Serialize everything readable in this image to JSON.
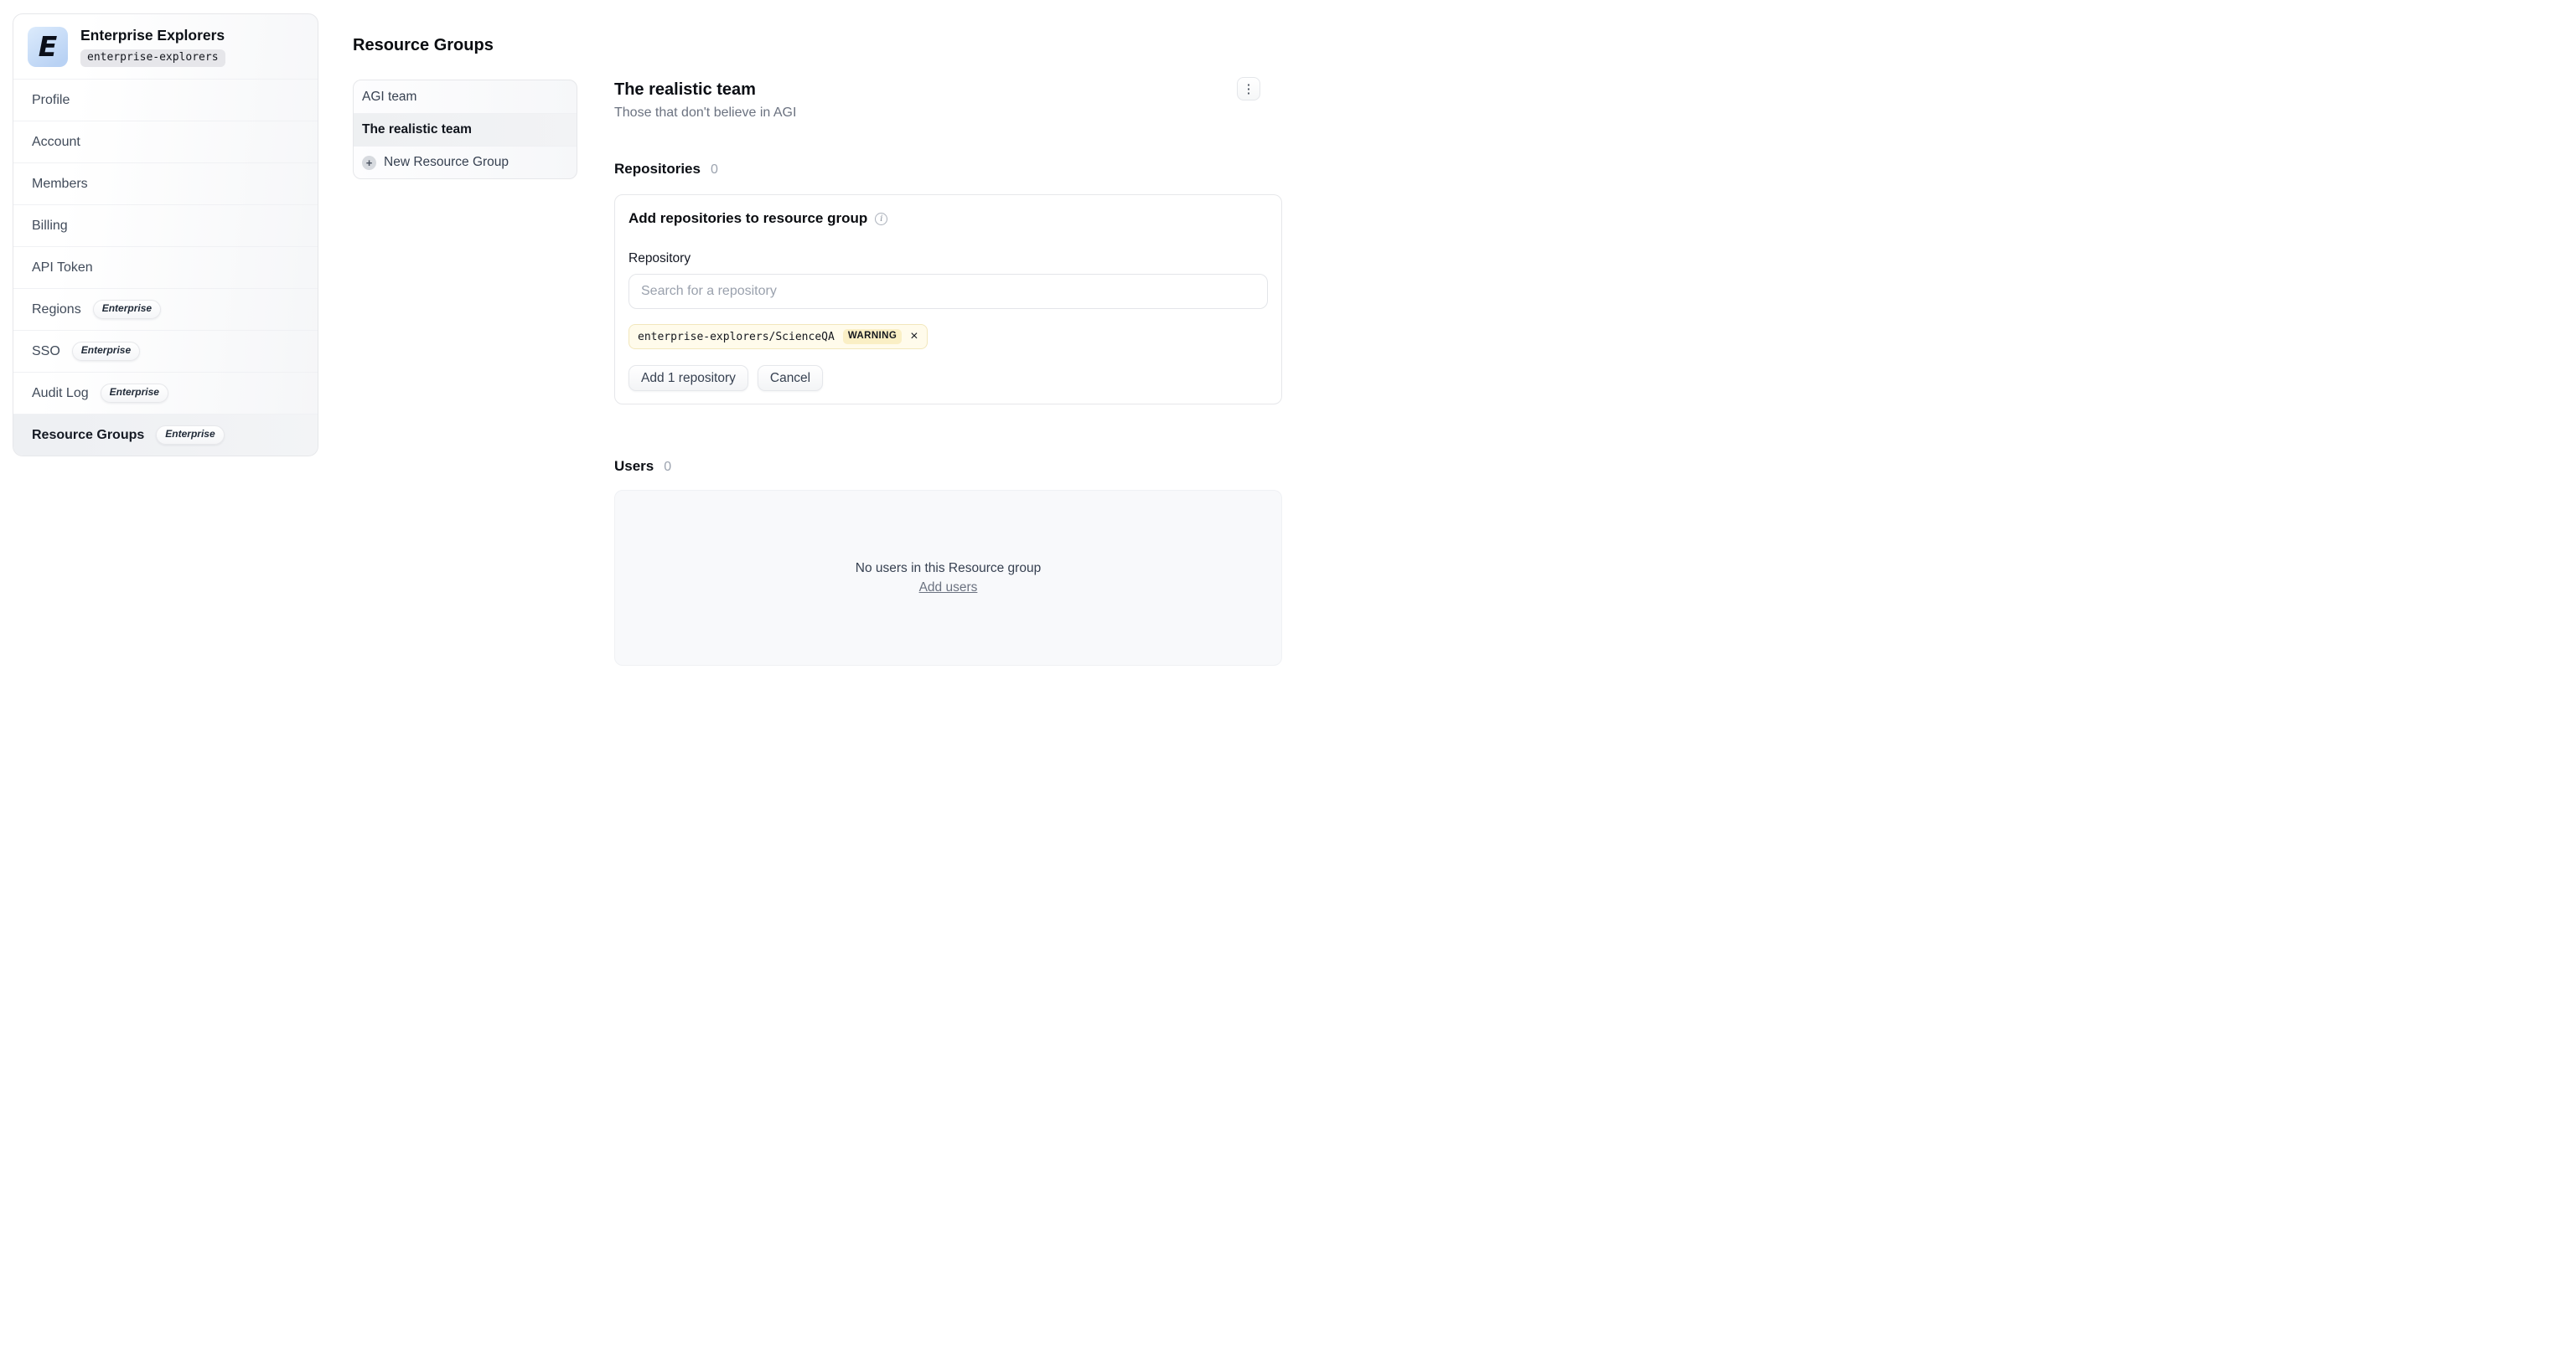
{
  "org": {
    "name": "Enterprise Explorers",
    "slug": "enterprise-explorers",
    "logo_letter": "E"
  },
  "sidebar": {
    "items": [
      {
        "label": "Profile"
      },
      {
        "label": "Account"
      },
      {
        "label": "Members"
      },
      {
        "label": "Billing"
      },
      {
        "label": "API Token"
      },
      {
        "label": "Regions",
        "badge": "Enterprise"
      },
      {
        "label": "SSO",
        "badge": "Enterprise"
      },
      {
        "label": "Audit Log",
        "badge": "Enterprise"
      },
      {
        "label": "Resource Groups",
        "badge": "Enterprise",
        "selected": true
      }
    ]
  },
  "groups": {
    "heading": "Resource Groups",
    "items": [
      {
        "label": "AGI team",
        "selected": false
      },
      {
        "label": "The realistic team",
        "selected": true
      }
    ],
    "new_label": "New Resource Group"
  },
  "detail": {
    "title": "The realistic team",
    "subtitle": "Those that don't believe in AGI",
    "repositories": {
      "heading": "Repositories",
      "count": "0",
      "add_panel": {
        "title": "Add repositories to resource group",
        "field_label": "Repository",
        "search_placeholder": "Search for a repository",
        "selected_repo": "enterprise-explorers/ScienceQA",
        "selected_repo_badge": "WARNING",
        "add_button": "Add 1 repository",
        "cancel_button": "Cancel"
      }
    },
    "users": {
      "heading": "Users",
      "count": "0",
      "empty_text": "No users in this Resource group",
      "add_link": "Add users"
    }
  },
  "icons": {
    "kebab": "⋮",
    "info": "i",
    "plus": "+",
    "close": "×"
  },
  "colors": {
    "accent_warning_bg": "#fffbeb",
    "accent_warning_badge_bg": "#faefc5",
    "logo_bg": "#c5d9f6",
    "selected_row_bg": "#f2f3f5",
    "border": "#e6e7ea"
  }
}
